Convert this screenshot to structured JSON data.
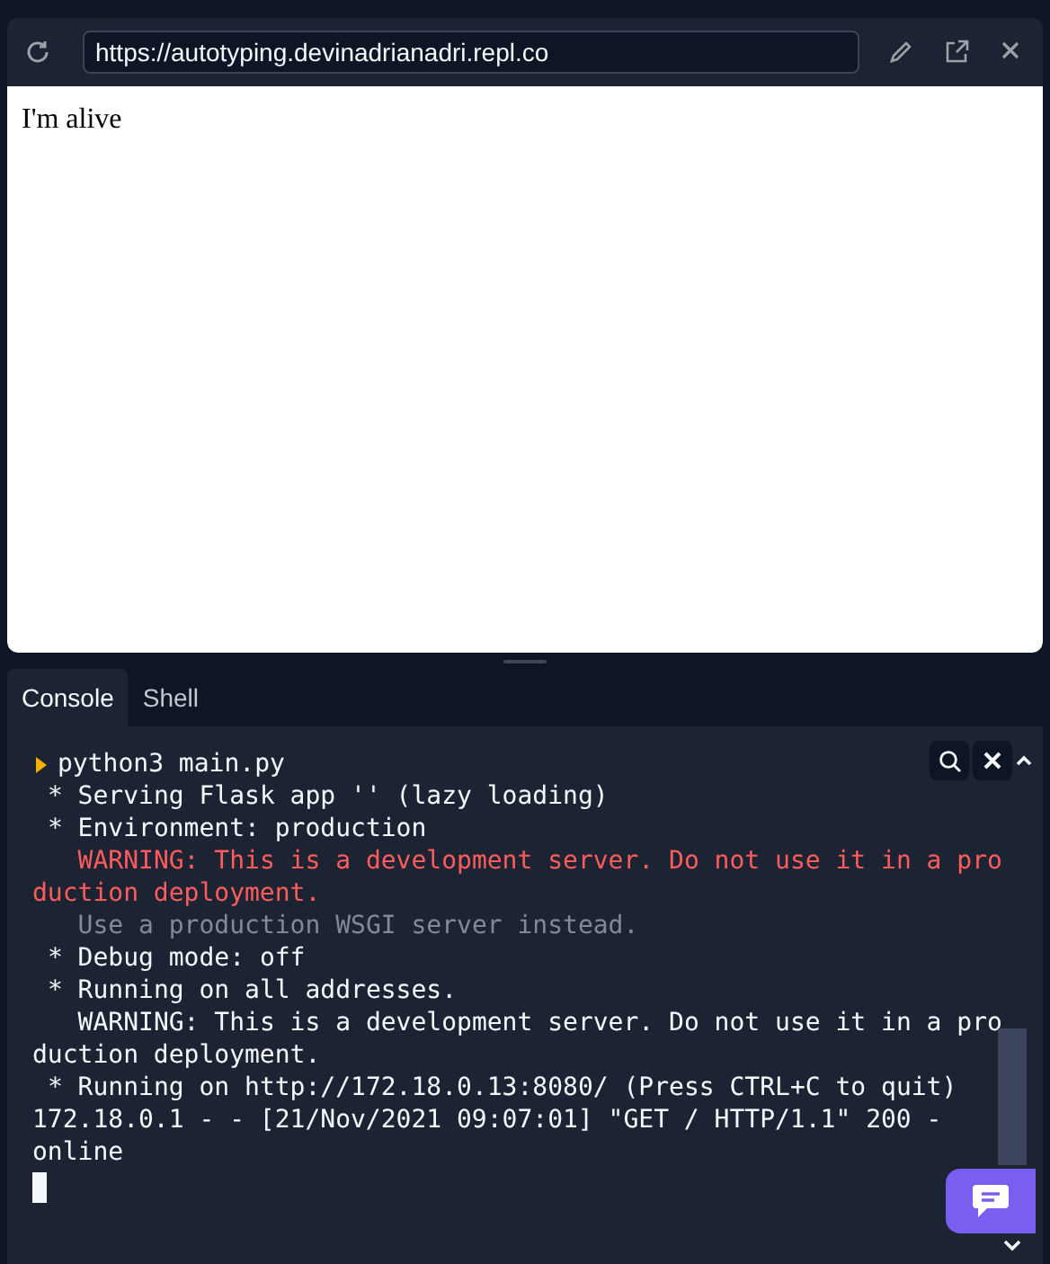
{
  "browser": {
    "url": "https://autotyping.devinadrianadri.repl.co",
    "page_text": "I'm alive"
  },
  "tabs": [
    {
      "label": "Console",
      "selected": true
    },
    {
      "label": "Shell",
      "selected": false
    }
  ],
  "console": {
    "lines": [
      {
        "kind": "prompt",
        "text": "python3 main.py"
      },
      {
        "kind": "output",
        "text": " * Serving Flask app '' (lazy loading)"
      },
      {
        "kind": "output",
        "text": " * Environment: production"
      },
      {
        "kind": "error",
        "text": "   WARNING: This is a development server. Do not use it in a production deployment."
      },
      {
        "kind": "muted",
        "text": "   Use a production WSGI server instead."
      },
      {
        "kind": "output",
        "text": " * Debug mode: off"
      },
      {
        "kind": "output",
        "text": " * Running on all addresses."
      },
      {
        "kind": "output",
        "text": "   WARNING: This is a development server. Do not use it in a production deployment."
      },
      {
        "kind": "output",
        "text": " * Running on http://172.18.0.13:8080/ (Press CTRL+C to quit)"
      },
      {
        "kind": "output",
        "text": "172.18.0.1 - - [21/Nov/2021 09:07:01] \"GET / HTTP/1.1\" 200 -"
      },
      {
        "kind": "output",
        "text": "online"
      }
    ]
  }
}
